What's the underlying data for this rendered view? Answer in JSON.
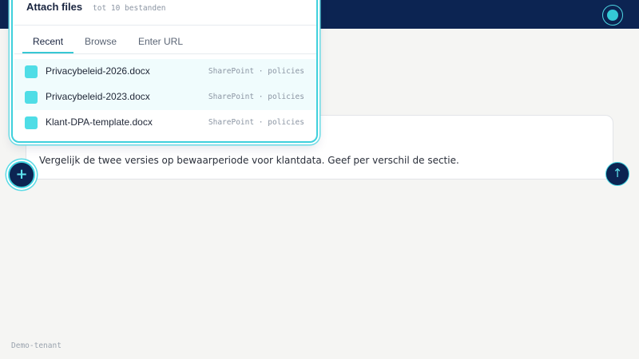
{
  "attach_popup": {
    "title": "Attach files",
    "subtitle": "tot 10 bestanden",
    "tabs": [
      {
        "label": "Recent",
        "active": true
      },
      {
        "label": "Browse",
        "active": false
      },
      {
        "label": "Enter URL",
        "active": false
      }
    ],
    "files": [
      {
        "name": "Privacybeleid-2026.docx",
        "source": "SharePoint · policies",
        "highlighted": true
      },
      {
        "name": "Privacybeleid-2023.docx",
        "source": "SharePoint · policies",
        "highlighted": true
      },
      {
        "name": "Klant-DPA-template.docx",
        "source": "SharePoint · policies",
        "highlighted": false
      }
    ]
  },
  "composer": {
    "prompt": "Vergelijk de twee versies op bewaarperiode voor klantdata. Geef per verschil de sectie."
  },
  "footer": {
    "tenant": "Demo-tenant"
  },
  "colors": {
    "header": "#0c2452",
    "accent": "#3fd0dc",
    "file_icon": "#4fdde6",
    "background": "#f5f5f3"
  },
  "icons": {
    "add": "plus-icon",
    "send": "arrow-up-icon",
    "status": "status-dot-icon",
    "file": "document-icon"
  }
}
